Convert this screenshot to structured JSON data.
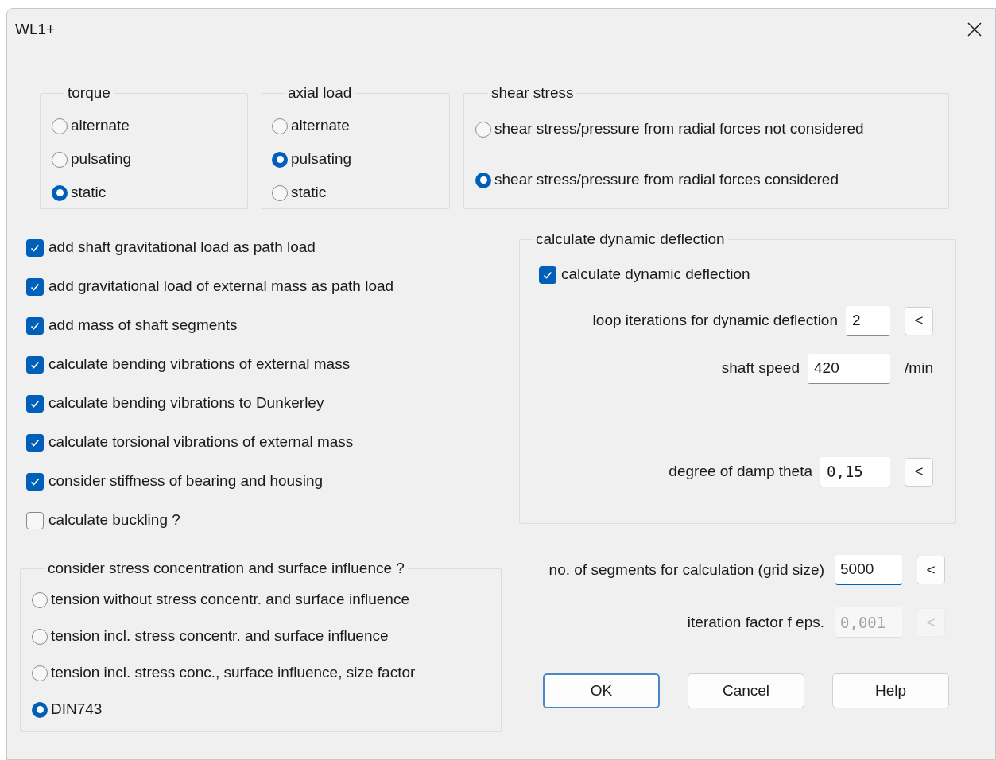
{
  "window": {
    "title": "WL1+"
  },
  "groups": [
    {
      "title": "torque",
      "options": [
        {
          "label": "alternate",
          "selected": false
        },
        {
          "label": "pulsating",
          "selected": false
        },
        {
          "label": "static",
          "selected": true
        }
      ]
    },
    {
      "title": "axial load",
      "options": [
        {
          "label": "alternate",
          "selected": false
        },
        {
          "label": "pulsating",
          "selected": true
        },
        {
          "label": "static",
          "selected": false
        }
      ]
    },
    {
      "title": "shear stress",
      "options": [
        {
          "label": "shear stress/pressure from radial forces not considered",
          "selected": false
        },
        {
          "label": "shear stress/pressure from radial forces considered",
          "selected": true
        }
      ]
    }
  ],
  "checkboxes": [
    {
      "label": "add shaft gravitational load as path load",
      "checked": true
    },
    {
      "label": "add gravitational load of external mass as path load",
      "checked": true
    },
    {
      "label": "add mass of shaft segments",
      "checked": true
    },
    {
      "label": "calculate bending vibrations of external mass",
      "checked": true
    },
    {
      "label": "calculate bending vibrations to Dunkerley",
      "checked": true
    },
    {
      "label": "calculate torsional vibrations of external mass",
      "checked": true
    },
    {
      "label": "consider stiffness of bearing and housing",
      "checked": true
    },
    {
      "label": "calculate buckling ?",
      "checked": false
    }
  ],
  "stress_group": {
    "title": "consider stress concentration and surface influence ?",
    "options": [
      {
        "label": "tension without stress concentr. and surface influence",
        "selected": false
      },
      {
        "label": "tension incl. stress concentr. and surface influence",
        "selected": false
      },
      {
        "label": "tension incl. stress conc., surface influence, size factor",
        "selected": false
      },
      {
        "label": "DIN743",
        "selected": true
      }
    ]
  },
  "dynamic_group": {
    "title": "calculate dynamic deflection",
    "checkbox": {
      "label": "calculate dynamic deflection",
      "checked": true
    },
    "rows": [
      {
        "kind": "button",
        "label": "loop iterations for dynamic deflection",
        "value": "2",
        "button": "<"
      },
      {
        "kind": "unit",
        "label": "shaft speed",
        "value": "420",
        "unit": "/min"
      },
      {
        "kind": "button",
        "label": "degree of damp theta",
        "value": "0,15",
        "button": "<"
      }
    ]
  },
  "fields": [
    {
      "label": "no. of segments for calculation (grid size)",
      "value": "5000",
      "button": "<",
      "focused": true,
      "disabled": false
    },
    {
      "label": "iteration factor f eps.",
      "value": "0,001",
      "button": "<",
      "focused": false,
      "disabled": true
    }
  ],
  "buttons": [
    {
      "label": "OK",
      "default": true
    },
    {
      "label": "Cancel",
      "default": false
    },
    {
      "label": "Help",
      "default": false
    }
  ]
}
